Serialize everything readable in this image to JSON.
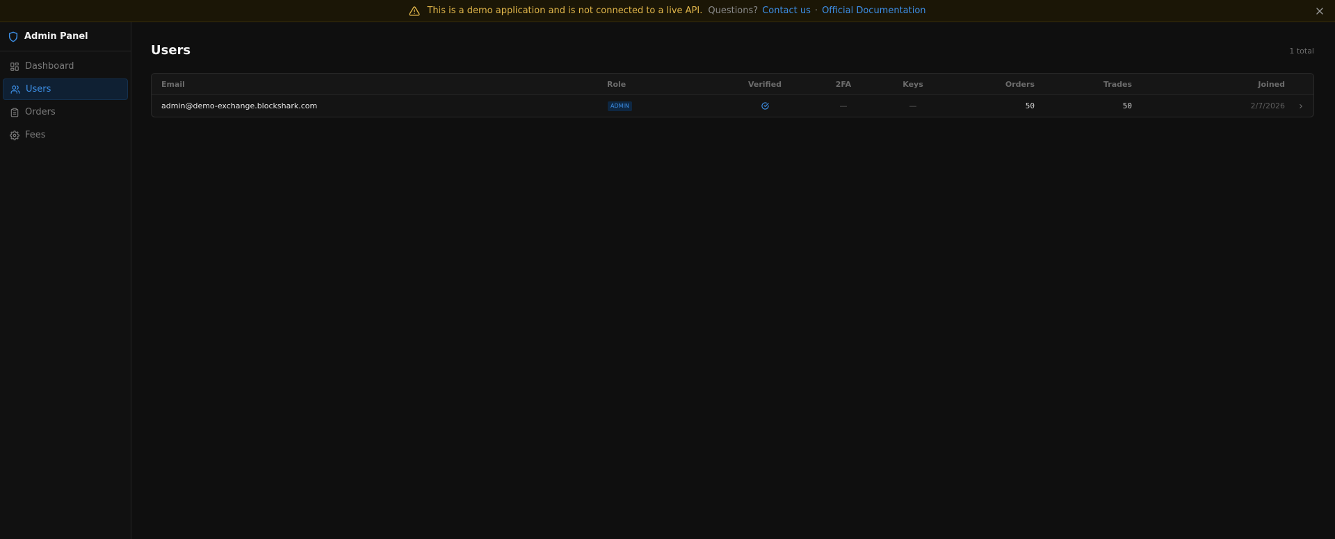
{
  "banner": {
    "message": "This is a demo application and is not connected to a live API.",
    "questions": "Questions?",
    "contact_label": "Contact us",
    "separator": "·",
    "docs_label": "Official Documentation",
    "warning_color": "#e0b54a",
    "link_color": "#3d8fe6"
  },
  "sidebar": {
    "title": "Admin Panel",
    "items": [
      {
        "label": "Dashboard",
        "icon": "layout-grid-icon",
        "active": false
      },
      {
        "label": "Users",
        "icon": "users-icon",
        "active": true
      },
      {
        "label": "Orders",
        "icon": "clipboard-icon",
        "active": false
      },
      {
        "label": "Fees",
        "icon": "gear-icon",
        "active": false
      }
    ]
  },
  "page": {
    "title": "Users",
    "total": "1 total"
  },
  "table": {
    "columns": [
      "Email",
      "Role",
      "Verified",
      "2FA",
      "Keys",
      "Orders",
      "Trades",
      "Joined"
    ],
    "rows": [
      {
        "email": "admin@demo-exchange.blockshark.com",
        "role": "ADMIN",
        "verified": true,
        "two_fa": "—",
        "keys": "—",
        "orders": "50",
        "trades": "50",
        "joined": "2/7/2026"
      }
    ]
  }
}
